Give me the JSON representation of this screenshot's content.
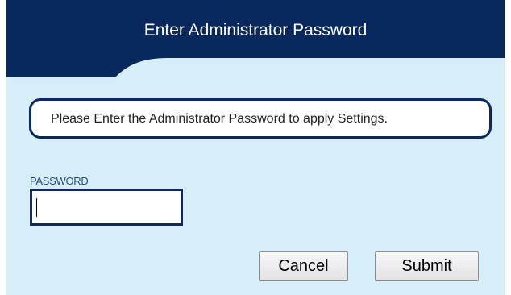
{
  "dialog": {
    "title": "Enter Administrator Password",
    "message": "Please Enter the Administrator Password to apply Settings.",
    "password_field": {
      "label": "PASSWORD",
      "value": "",
      "placeholder": ""
    },
    "buttons": {
      "cancel_label": "Cancel",
      "submit_label": "Submit"
    }
  },
  "colors": {
    "header_background": "#08285e",
    "dialog_background": "#d6eef8",
    "border_accent": "#0a2960"
  }
}
